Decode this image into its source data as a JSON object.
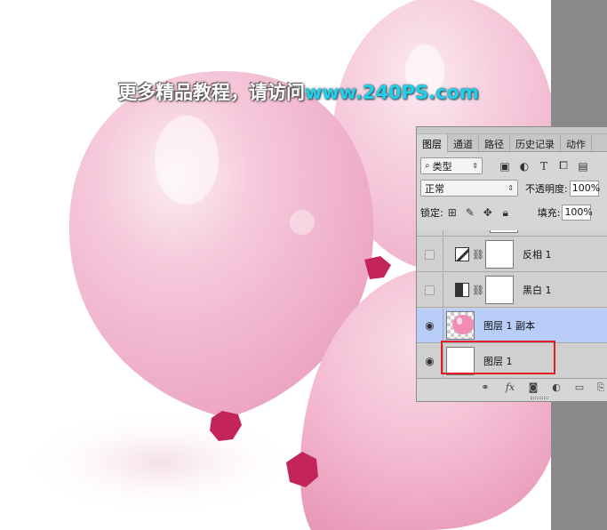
{
  "watermark": {
    "text_cn": "更多精品教程，请访问",
    "text_url": "www.240PS.com"
  },
  "layers_panel": {
    "tabs": [
      {
        "label": "图层",
        "active": true
      },
      {
        "label": "通道",
        "active": false
      },
      {
        "label": "路径",
        "active": false
      },
      {
        "label": "历史记录",
        "active": false
      },
      {
        "label": "动作",
        "active": false
      }
    ],
    "filter": {
      "icon": "search-icon",
      "label": "类型"
    },
    "filter_icons": [
      "image-filter-icon",
      "adjustment-filter-icon",
      "type-filter-icon",
      "shape-filter-icon",
      "smart-object-filter-icon"
    ],
    "blend_mode": "正常",
    "opacity_label": "不透明度:",
    "opacity_value": "100%",
    "lock_label": "锁定:",
    "fill_label": "填充:",
    "fill_value": "100%",
    "layers": [
      {
        "name": "反相 1",
        "type": "adjustment-invert",
        "visible": false,
        "selected": false
      },
      {
        "name": "黑白 1",
        "type": "adjustment-black-white",
        "visible": false,
        "selected": false
      },
      {
        "name": "图层 1 副本",
        "type": "pixel",
        "visible": true,
        "selected": true
      },
      {
        "name": "图层 1",
        "type": "pixel",
        "visible": true,
        "selected": false,
        "highlighted": true
      }
    ],
    "footer_icons": [
      "link-icon",
      "fx-icon",
      "mask-icon",
      "adjustment-icon",
      "folder-icon",
      "new-layer-icon"
    ],
    "footer_fx": "fx",
    "colors": {
      "selected_row": "#b8cef8",
      "highlight_box": "#e21d25",
      "panel_bg": "#d6d6d6"
    }
  }
}
